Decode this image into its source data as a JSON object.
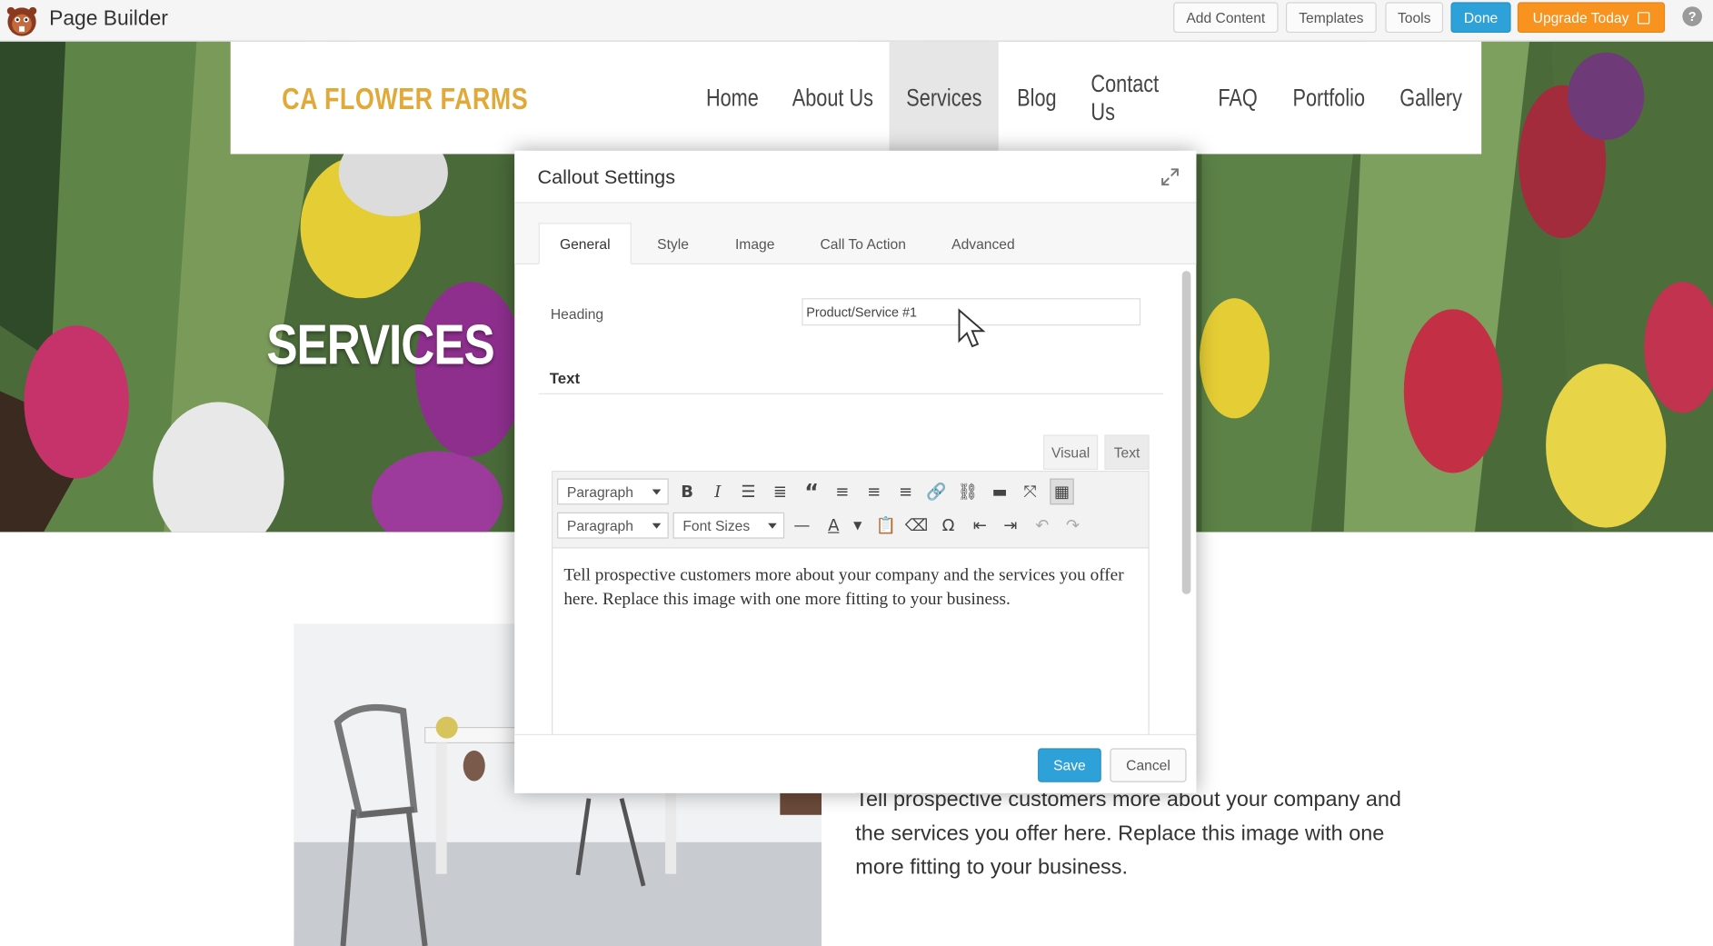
{
  "app": {
    "title": "Page Builder",
    "buttons": {
      "add_content": "Add Content",
      "templates": "Templates",
      "tools": "Tools",
      "done": "Done",
      "upgrade": "Upgrade Today",
      "help": "?"
    },
    "colors": {
      "done": "#2ea2d8",
      "upgrade": "#f7931e"
    }
  },
  "site": {
    "logo": "CA FLOWER FARMS",
    "nav": [
      "Home",
      "About Us",
      "Services",
      "Blog",
      "Contact Us",
      "FAQ",
      "Portfolio",
      "Gallery"
    ],
    "active_nav": "Services",
    "hero_title": "SERVICES",
    "body_text": "Tell prospective customers more about your company and the services you offer here.  Replace this image with one more fitting to your business.",
    "colors": {
      "logo": "#e0a93a"
    }
  },
  "modal": {
    "title": "Callout Settings",
    "tabs": [
      "General",
      "Style",
      "Image",
      "Call To Action",
      "Advanced"
    ],
    "active_tab": "General",
    "heading_label": "Heading",
    "heading_value": "Product/Service #1",
    "text_label": "Text",
    "mode_visual": "Visual",
    "mode_text": "Text",
    "format_select": "Paragraph",
    "format_select_2": "Paragraph",
    "font_sizes": "Font Sizes",
    "editor_text": "Tell prospective customers more about your company and the services you offer here.  Replace this image with one more fitting to your business.",
    "save": "Save",
    "cancel": "Cancel"
  }
}
